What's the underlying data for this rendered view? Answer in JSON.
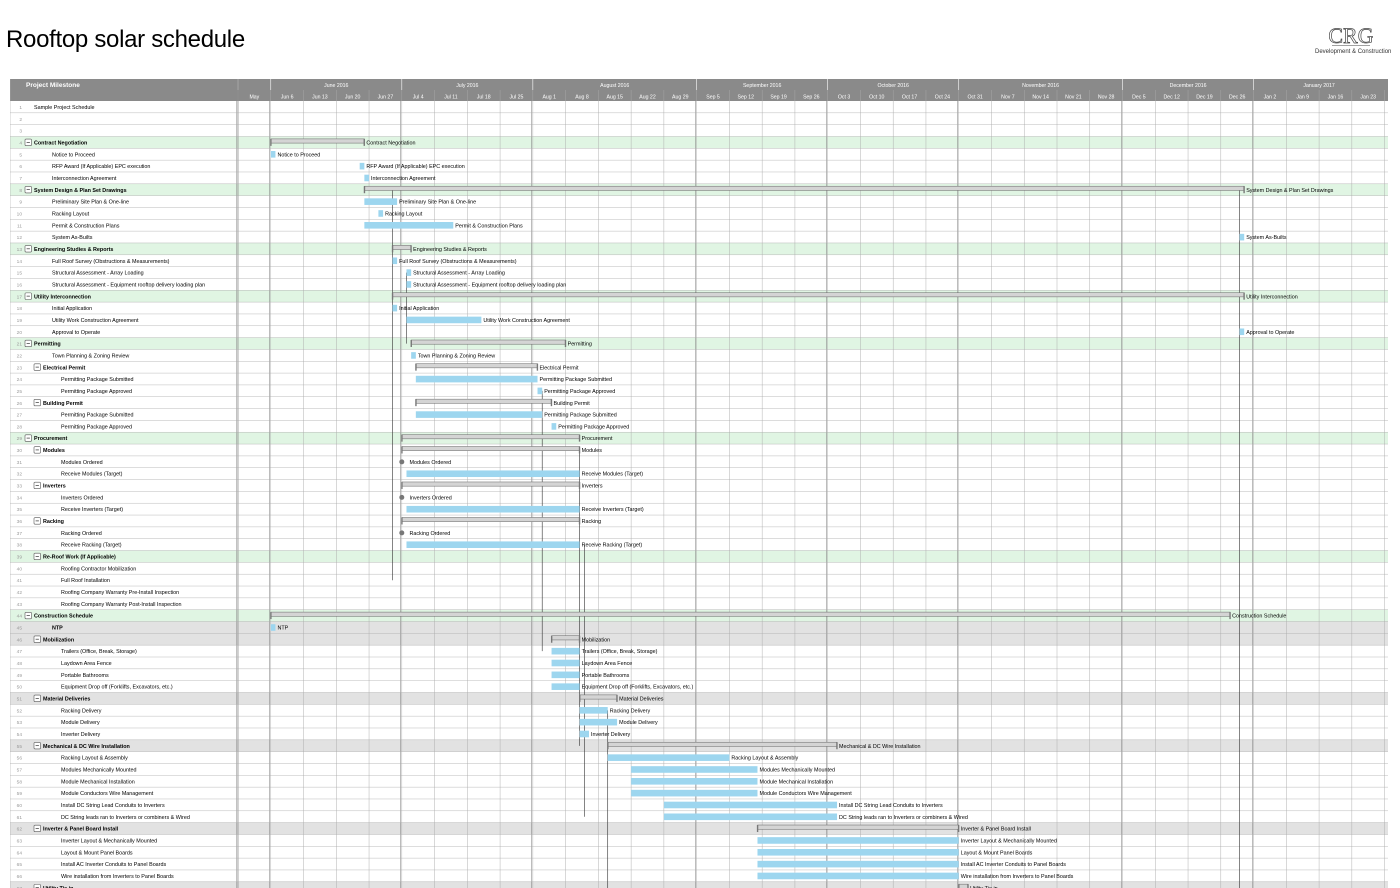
{
  "page": {
    "title": "Rooftop solar schedule",
    "logo": {
      "mark": "CRG",
      "subtitle": "Development & Construction"
    }
  },
  "chart_data": {
    "type": "gantt",
    "columns": {
      "task": "Project Milestone"
    },
    "timeline": {
      "start": "2016-05-30",
      "months": [
        {
          "label": "May",
          "start": "2016-05-30",
          "end": "2016-06-06"
        },
        {
          "label": "June 2016",
          "start": "2016-06-06",
          "end": "2016-07-04"
        },
        {
          "label": "July 2016",
          "start": "2016-07-04",
          "end": "2016-08-01"
        },
        {
          "label": "August 2016",
          "start": "2016-08-01",
          "end": "2016-09-05"
        },
        {
          "label": "September 2016",
          "start": "2016-09-05",
          "end": "2016-10-03"
        },
        {
          "label": "October 2016",
          "start": "2016-10-03",
          "end": "2016-10-31"
        },
        {
          "label": "November 2016",
          "start": "2016-10-31",
          "end": "2016-12-05"
        },
        {
          "label": "December 2016",
          "start": "2016-12-05",
          "end": "2017-01-02"
        },
        {
          "label": "January 2017",
          "start": "2017-01-02",
          "end": "2017-01-30"
        }
      ],
      "weeks": [
        "May",
        "Jun 6",
        "Jun 13",
        "Jun 20",
        "Jun 27",
        "Jul 4",
        "Jul 11",
        "Jul 18",
        "Jul 25",
        "Aug 1",
        "Aug 8",
        "Aug 15",
        "Aug 22",
        "Aug 29",
        "Sep 5",
        "Sep 12",
        "Sep 19",
        "Sep 26",
        "Oct 3",
        "Oct 10",
        "Oct 17",
        "Oct 24",
        "Oct 31",
        "Nov 7",
        "Nov 14",
        "Nov 21",
        "Nov 28",
        "Dec 5",
        "Dec 12",
        "Dec 19",
        "Dec 26",
        "Jan 2",
        "Jan 9",
        "Jan 16",
        "Jan 23"
      ]
    },
    "rows": [
      {
        "n": 1,
        "name": "Sample Project Schedule",
        "kind": "plain",
        "indent": 0
      },
      {
        "n": 2,
        "name": "",
        "kind": "plain",
        "indent": 0
      },
      {
        "n": 3,
        "name": "",
        "kind": "plain",
        "indent": 0
      },
      {
        "n": 4,
        "name": "Contract Negotiation",
        "kind": "phase",
        "indent": 0,
        "start": "2016-06-06",
        "end": "2016-06-26",
        "label": "Contract Negotiation"
      },
      {
        "n": 5,
        "name": "Notice to Proceed",
        "kind": "task",
        "indent": 1,
        "start": "2016-06-06",
        "end": "2016-06-07",
        "label": "Notice to Proceed"
      },
      {
        "n": 6,
        "name": "RFP Award (If Applicable) EPC execution",
        "kind": "task",
        "indent": 1,
        "start": "2016-06-25",
        "end": "2016-06-26",
        "label": "RFP Award (If Applicable) EPC execution"
      },
      {
        "n": 7,
        "name": "Interconnection Agreement",
        "kind": "task",
        "indent": 1,
        "start": "2016-06-26",
        "end": "2016-06-27",
        "label": "Interconnection Agreement"
      },
      {
        "n": 8,
        "name": "System Design & Plan Set Drawings",
        "kind": "phase",
        "indent": 0,
        "start": "2016-06-26",
        "end": "2016-12-31",
        "label": "System Design & Plan Set Drawings"
      },
      {
        "n": 9,
        "name": "Preliminary Site Plan & One-line",
        "kind": "task",
        "indent": 1,
        "start": "2016-06-26",
        "end": "2016-07-03",
        "label": "Preliminary Site Plan & One-line"
      },
      {
        "n": 10,
        "name": "Racking Layout",
        "kind": "task",
        "indent": 1,
        "start": "2016-06-29",
        "end": "2016-06-30",
        "label": "Racking Layout"
      },
      {
        "n": 11,
        "name": "Permit & Construction Plans",
        "kind": "task",
        "indent": 1,
        "start": "2016-06-26",
        "end": "2016-07-15",
        "label": "Permit & Construction Plans"
      },
      {
        "n": 12,
        "name": "System As-Builts",
        "kind": "task",
        "indent": 1,
        "start": "2016-12-30",
        "end": "2016-12-31",
        "label": "System As-Builts"
      },
      {
        "n": 13,
        "name": "Engineering Studies & Reports",
        "kind": "phase",
        "indent": 0,
        "start": "2016-07-02",
        "end": "2016-07-06",
        "label": "Engineering Studies & Reports"
      },
      {
        "n": 14,
        "name": "Full Roof Survey (Obstructions & Measurements)",
        "kind": "task",
        "indent": 1,
        "start": "2016-07-02",
        "end": "2016-07-03",
        "label": "Full Roof Survey (Obstructions & Measurements)"
      },
      {
        "n": 15,
        "name": "Structural Assessment - Array Loading",
        "kind": "task",
        "indent": 1,
        "start": "2016-07-05",
        "end": "2016-07-06",
        "label": "Structural Assessment - Array Loading"
      },
      {
        "n": 16,
        "name": "Structural Assessment - Equipment rooftop delivery loading plan",
        "kind": "task",
        "indent": 1,
        "start": "2016-07-05",
        "end": "2016-07-06",
        "label": "Structural Assessment - Equipment rooftop delivery loading plan"
      },
      {
        "n": 17,
        "name": "Utility Interconnection",
        "kind": "phase",
        "indent": 0,
        "start": "2016-07-02",
        "end": "2016-12-31",
        "label": "Utility Interconnection"
      },
      {
        "n": 18,
        "name": "Initial Application",
        "kind": "task",
        "indent": 1,
        "start": "2016-07-02",
        "end": "2016-07-03",
        "label": "Initial Application"
      },
      {
        "n": 19,
        "name": "Utility Work Construction Agreement",
        "kind": "task",
        "indent": 1,
        "start": "2016-07-05",
        "end": "2016-07-21",
        "label": "Utility Work Construction Agreement"
      },
      {
        "n": 20,
        "name": "Approval to Operate",
        "kind": "task",
        "indent": 1,
        "start": "2016-12-30",
        "end": "2016-12-31",
        "label": "Approval to Operate"
      },
      {
        "n": 21,
        "name": "Permitting",
        "kind": "phase",
        "indent": 0,
        "start": "2016-07-06",
        "end": "2016-08-08",
        "label": "Permitting"
      },
      {
        "n": 22,
        "name": "Town Planning & Zoning Review",
        "kind": "task",
        "indent": 1,
        "start": "2016-07-06",
        "end": "2016-07-07",
        "label": "Town Planning & Zoning Review"
      },
      {
        "n": 23,
        "name": "Electrical Permit",
        "kind": "group",
        "indent": 1,
        "start": "2016-07-07",
        "end": "2016-08-02",
        "label": "Electrical Permit"
      },
      {
        "n": 24,
        "name": "Permitting Package Submitted",
        "kind": "task",
        "indent": 2,
        "start": "2016-07-07",
        "end": "2016-08-02",
        "label": "Permitting Package Submitted"
      },
      {
        "n": 25,
        "name": "Permitting Package Approved",
        "kind": "task",
        "indent": 2,
        "start": "2016-08-02",
        "end": "2016-08-03",
        "label": "Permitting Package Approved"
      },
      {
        "n": 26,
        "name": "Building Permit",
        "kind": "group",
        "indent": 1,
        "start": "2016-07-07",
        "end": "2016-08-05",
        "label": "Building Permit"
      },
      {
        "n": 27,
        "name": "Permitting Package Submitted",
        "kind": "task",
        "indent": 2,
        "start": "2016-07-07",
        "end": "2016-08-03",
        "label": "Permitting Package Submitted"
      },
      {
        "n": 28,
        "name": "Permitting Package Approved",
        "kind": "task",
        "indent": 2,
        "start": "2016-08-05",
        "end": "2016-08-06",
        "label": "Permitting Package Approved"
      },
      {
        "n": 29,
        "name": "Procurement",
        "kind": "phase",
        "indent": 0,
        "start": "2016-07-04",
        "end": "2016-08-11",
        "label": "Procurement"
      },
      {
        "n": 30,
        "name": "Modules",
        "kind": "group",
        "indent": 1,
        "start": "2016-07-04",
        "end": "2016-08-11",
        "label": "Modules"
      },
      {
        "n": 31,
        "name": "Modules Ordered",
        "kind": "milestone",
        "indent": 2,
        "start": "2016-07-04",
        "end": "2016-07-05",
        "label": "Modules Ordered"
      },
      {
        "n": 32,
        "name": "Receive Modules (Target)",
        "kind": "task",
        "indent": 2,
        "start": "2016-07-05",
        "end": "2016-08-11",
        "label": "Receive Modules (Target)"
      },
      {
        "n": 33,
        "name": "Inverters",
        "kind": "group",
        "indent": 1,
        "start": "2016-07-04",
        "end": "2016-08-11",
        "label": "Inverters"
      },
      {
        "n": 34,
        "name": "Inverters Ordered",
        "kind": "milestone",
        "indent": 2,
        "start": "2016-07-04",
        "end": "2016-07-05",
        "label": "Inverters Ordered"
      },
      {
        "n": 35,
        "name": "Receive Inverters (Target)",
        "kind": "task",
        "indent": 2,
        "start": "2016-07-05",
        "end": "2016-08-11",
        "label": "Receive Inverters (Target)"
      },
      {
        "n": 36,
        "name": "Racking",
        "kind": "group",
        "indent": 1,
        "start": "2016-07-04",
        "end": "2016-08-11",
        "label": "Racking"
      },
      {
        "n": 37,
        "name": "Racking Ordered",
        "kind": "milestone",
        "indent": 2,
        "start": "2016-07-04",
        "end": "2016-07-05",
        "label": "Racking Ordered"
      },
      {
        "n": 38,
        "name": "Receive Racking (Target)",
        "kind": "task",
        "indent": 2,
        "start": "2016-07-05",
        "end": "2016-08-11",
        "label": "Receive Racking (Target)"
      },
      {
        "n": 39,
        "name": "Re-Roof Work (If Applicable)",
        "kind": "phase",
        "indent": 1,
        "label": ""
      },
      {
        "n": 40,
        "name": "Roofing Contractor Mobilization",
        "kind": "task",
        "indent": 2
      },
      {
        "n": 41,
        "name": "Full Roof Installation",
        "kind": "task",
        "indent": 2
      },
      {
        "n": 42,
        "name": "Roofing Company Warranty Pre-Install Inspection",
        "kind": "task",
        "indent": 2
      },
      {
        "n": 43,
        "name": "Roofing Company Warranty Post-Install Inspection",
        "kind": "task",
        "indent": 2
      },
      {
        "n": 44,
        "name": "Construction Schedule",
        "kind": "phase",
        "indent": 0,
        "start": "2016-06-06",
        "end": "2016-12-28",
        "label": "Construction Schedule"
      },
      {
        "n": 45,
        "name": "NTP",
        "kind": "subphase",
        "indent": 1,
        "start": "2016-06-06",
        "end": "2016-06-07",
        "label": "NTP"
      },
      {
        "n": 46,
        "name": "Mobilization",
        "kind": "subphase",
        "indent": 1,
        "start": "2016-08-05",
        "end": "2016-08-11",
        "label": "Mobilization"
      },
      {
        "n": 47,
        "name": "Trailers (Office, Break, Storage)",
        "kind": "task",
        "indent": 2,
        "start": "2016-08-05",
        "end": "2016-08-11",
        "label": "Trailers (Office, Break, Storage)"
      },
      {
        "n": 48,
        "name": "Laydown Area Fence",
        "kind": "task",
        "indent": 2,
        "start": "2016-08-05",
        "end": "2016-08-11",
        "label": "Laydown Area Fence"
      },
      {
        "n": 49,
        "name": "Portable Bathrooms",
        "kind": "task",
        "indent": 2,
        "start": "2016-08-05",
        "end": "2016-08-11",
        "label": "Portable Bathrooms"
      },
      {
        "n": 50,
        "name": "Equipment Drop off (Forklifts, Excavators, etc.)",
        "kind": "task",
        "indent": 2,
        "start": "2016-08-05",
        "end": "2016-08-11",
        "label": "Equipment Drop off (Forklifts, Excavators, etc.)"
      },
      {
        "n": 51,
        "name": "Material Deliveries",
        "kind": "subphase",
        "indent": 1,
        "start": "2016-08-11",
        "end": "2016-08-19",
        "label": "Material Deliveries"
      },
      {
        "n": 52,
        "name": "Racking Delivery",
        "kind": "task",
        "indent": 2,
        "start": "2016-08-11",
        "end": "2016-08-17",
        "label": "Racking Delivery"
      },
      {
        "n": 53,
        "name": "Module Delivery",
        "kind": "task",
        "indent": 2,
        "start": "2016-08-11",
        "end": "2016-08-19",
        "label": "Module Delivery"
      },
      {
        "n": 54,
        "name": "Inverter Delivery",
        "kind": "task",
        "indent": 2,
        "start": "2016-08-11",
        "end": "2016-08-13",
        "label": "Inverter Delivery"
      },
      {
        "n": 55,
        "name": "Mechanical & DC Wire Installation",
        "kind": "subphase",
        "indent": 1,
        "start": "2016-08-17",
        "end": "2016-10-05",
        "label": "Mechanical & DC Wire Installation"
      },
      {
        "n": 56,
        "name": "Racking Layout & Assembly",
        "kind": "task",
        "indent": 2,
        "start": "2016-08-17",
        "end": "2016-09-12",
        "label": "Racking Layout & Assembly"
      },
      {
        "n": 57,
        "name": "Modules Mechanically Mounted",
        "kind": "task",
        "indent": 2,
        "start": "2016-08-22",
        "end": "2016-09-18",
        "label": "Modules Mechanically Mounted"
      },
      {
        "n": 58,
        "name": "Module Mechanical Installation",
        "kind": "task",
        "indent": 2,
        "start": "2016-08-22",
        "end": "2016-09-18",
        "label": "Module Mechanical Installation"
      },
      {
        "n": 59,
        "name": "Module Conductors Wire Management",
        "kind": "task",
        "indent": 2,
        "start": "2016-08-22",
        "end": "2016-09-18",
        "label": "Module Conductors Wire Management"
      },
      {
        "n": 60,
        "name": "Install DC String Lead Conduits to Inverters",
        "kind": "task",
        "indent": 2,
        "start": "2016-08-29",
        "end": "2016-10-05",
        "label": "Install DC String Lead Conduits to Inverters"
      },
      {
        "n": 61,
        "name": "DC String leads ran to Inverters or combiners & Wired",
        "kind": "task",
        "indent": 2,
        "start": "2016-08-29",
        "end": "2016-10-05",
        "label": "DC String leads ran to Inverters or combiners & Wired"
      },
      {
        "n": 62,
        "name": "Inverter & Panel Board Install",
        "kind": "subphase",
        "indent": 1,
        "start": "2016-09-18",
        "end": "2016-10-31",
        "label": "Inverter & Panel Board Install"
      },
      {
        "n": 63,
        "name": "Inverter Layout & Mechanically Mounted",
        "kind": "task",
        "indent": 2,
        "start": "2016-09-18",
        "end": "2016-10-31",
        "label": "Inverter Layout & Mechanically Mounted"
      },
      {
        "n": 64,
        "name": "Layout & Mount Panel Boards",
        "kind": "task",
        "indent": 2,
        "start": "2016-09-18",
        "end": "2016-10-31",
        "label": "Layout & Mount Panel Boards"
      },
      {
        "n": 65,
        "name": "Install AC Inverter Conduits to Panel Boards",
        "kind": "task",
        "indent": 2,
        "start": "2016-09-18",
        "end": "2016-10-31",
        "label": "Install AC Inverter Conduits to Panel Boards"
      },
      {
        "n": 66,
        "name": "Wire installation from Inverters to Panel Boards",
        "kind": "task",
        "indent": 2,
        "start": "2016-09-18",
        "end": "2016-10-31",
        "label": "Wire installation from Inverters to Panel Boards"
      },
      {
        "n": 67,
        "name": "Utility Tie in",
        "kind": "subphase",
        "indent": 1,
        "start": "2016-10-31",
        "end": "2016-11-02",
        "label": "Utility Tie in"
      }
    ],
    "colors": {
      "header": "#8a8a8a",
      "phase_row": "#e0f5e3",
      "subphase_row": "#e2e2e2",
      "task_bar": "#9dd6ef",
      "summary_bar": "#d4d4d4",
      "grid": "#a9a9a9",
      "link": "#333333"
    }
  }
}
